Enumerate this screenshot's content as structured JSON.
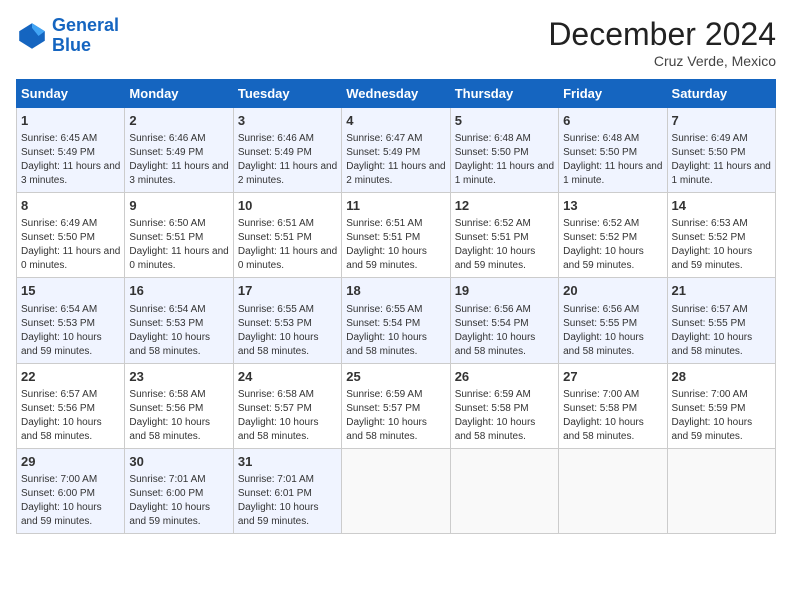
{
  "header": {
    "logo_line1": "General",
    "logo_line2": "Blue",
    "month_title": "December 2024",
    "location": "Cruz Verde, Mexico"
  },
  "weekdays": [
    "Sunday",
    "Monday",
    "Tuesday",
    "Wednesday",
    "Thursday",
    "Friday",
    "Saturday"
  ],
  "weeks": [
    [
      {
        "day": "1",
        "sunrise": "6:45 AM",
        "sunset": "5:49 PM",
        "daylight": "11 hours and 3 minutes."
      },
      {
        "day": "2",
        "sunrise": "6:46 AM",
        "sunset": "5:49 PM",
        "daylight": "11 hours and 3 minutes."
      },
      {
        "day": "3",
        "sunrise": "6:46 AM",
        "sunset": "5:49 PM",
        "daylight": "11 hours and 2 minutes."
      },
      {
        "day": "4",
        "sunrise": "6:47 AM",
        "sunset": "5:49 PM",
        "daylight": "11 hours and 2 minutes."
      },
      {
        "day": "5",
        "sunrise": "6:48 AM",
        "sunset": "5:50 PM",
        "daylight": "11 hours and 1 minute."
      },
      {
        "day": "6",
        "sunrise": "6:48 AM",
        "sunset": "5:50 PM",
        "daylight": "11 hours and 1 minute."
      },
      {
        "day": "7",
        "sunrise": "6:49 AM",
        "sunset": "5:50 PM",
        "daylight": "11 hours and 1 minute."
      }
    ],
    [
      {
        "day": "8",
        "sunrise": "6:49 AM",
        "sunset": "5:50 PM",
        "daylight": "11 hours and 0 minutes."
      },
      {
        "day": "9",
        "sunrise": "6:50 AM",
        "sunset": "5:51 PM",
        "daylight": "11 hours and 0 minutes."
      },
      {
        "day": "10",
        "sunrise": "6:51 AM",
        "sunset": "5:51 PM",
        "daylight": "11 hours and 0 minutes."
      },
      {
        "day": "11",
        "sunrise": "6:51 AM",
        "sunset": "5:51 PM",
        "daylight": "10 hours and 59 minutes."
      },
      {
        "day": "12",
        "sunrise": "6:52 AM",
        "sunset": "5:51 PM",
        "daylight": "10 hours and 59 minutes."
      },
      {
        "day": "13",
        "sunrise": "6:52 AM",
        "sunset": "5:52 PM",
        "daylight": "10 hours and 59 minutes."
      },
      {
        "day": "14",
        "sunrise": "6:53 AM",
        "sunset": "5:52 PM",
        "daylight": "10 hours and 59 minutes."
      }
    ],
    [
      {
        "day": "15",
        "sunrise": "6:54 AM",
        "sunset": "5:53 PM",
        "daylight": "10 hours and 59 minutes."
      },
      {
        "day": "16",
        "sunrise": "6:54 AM",
        "sunset": "5:53 PM",
        "daylight": "10 hours and 58 minutes."
      },
      {
        "day": "17",
        "sunrise": "6:55 AM",
        "sunset": "5:53 PM",
        "daylight": "10 hours and 58 minutes."
      },
      {
        "day": "18",
        "sunrise": "6:55 AM",
        "sunset": "5:54 PM",
        "daylight": "10 hours and 58 minutes."
      },
      {
        "day": "19",
        "sunrise": "6:56 AM",
        "sunset": "5:54 PM",
        "daylight": "10 hours and 58 minutes."
      },
      {
        "day": "20",
        "sunrise": "6:56 AM",
        "sunset": "5:55 PM",
        "daylight": "10 hours and 58 minutes."
      },
      {
        "day": "21",
        "sunrise": "6:57 AM",
        "sunset": "5:55 PM",
        "daylight": "10 hours and 58 minutes."
      }
    ],
    [
      {
        "day": "22",
        "sunrise": "6:57 AM",
        "sunset": "5:56 PM",
        "daylight": "10 hours and 58 minutes."
      },
      {
        "day": "23",
        "sunrise": "6:58 AM",
        "sunset": "5:56 PM",
        "daylight": "10 hours and 58 minutes."
      },
      {
        "day": "24",
        "sunrise": "6:58 AM",
        "sunset": "5:57 PM",
        "daylight": "10 hours and 58 minutes."
      },
      {
        "day": "25",
        "sunrise": "6:59 AM",
        "sunset": "5:57 PM",
        "daylight": "10 hours and 58 minutes."
      },
      {
        "day": "26",
        "sunrise": "6:59 AM",
        "sunset": "5:58 PM",
        "daylight": "10 hours and 58 minutes."
      },
      {
        "day": "27",
        "sunrise": "7:00 AM",
        "sunset": "5:58 PM",
        "daylight": "10 hours and 58 minutes."
      },
      {
        "day": "28",
        "sunrise": "7:00 AM",
        "sunset": "5:59 PM",
        "daylight": "10 hours and 59 minutes."
      }
    ],
    [
      {
        "day": "29",
        "sunrise": "7:00 AM",
        "sunset": "6:00 PM",
        "daylight": "10 hours and 59 minutes."
      },
      {
        "day": "30",
        "sunrise": "7:01 AM",
        "sunset": "6:00 PM",
        "daylight": "10 hours and 59 minutes."
      },
      {
        "day": "31",
        "sunrise": "7:01 AM",
        "sunset": "6:01 PM",
        "daylight": "10 hours and 59 minutes."
      },
      null,
      null,
      null,
      null
    ]
  ]
}
